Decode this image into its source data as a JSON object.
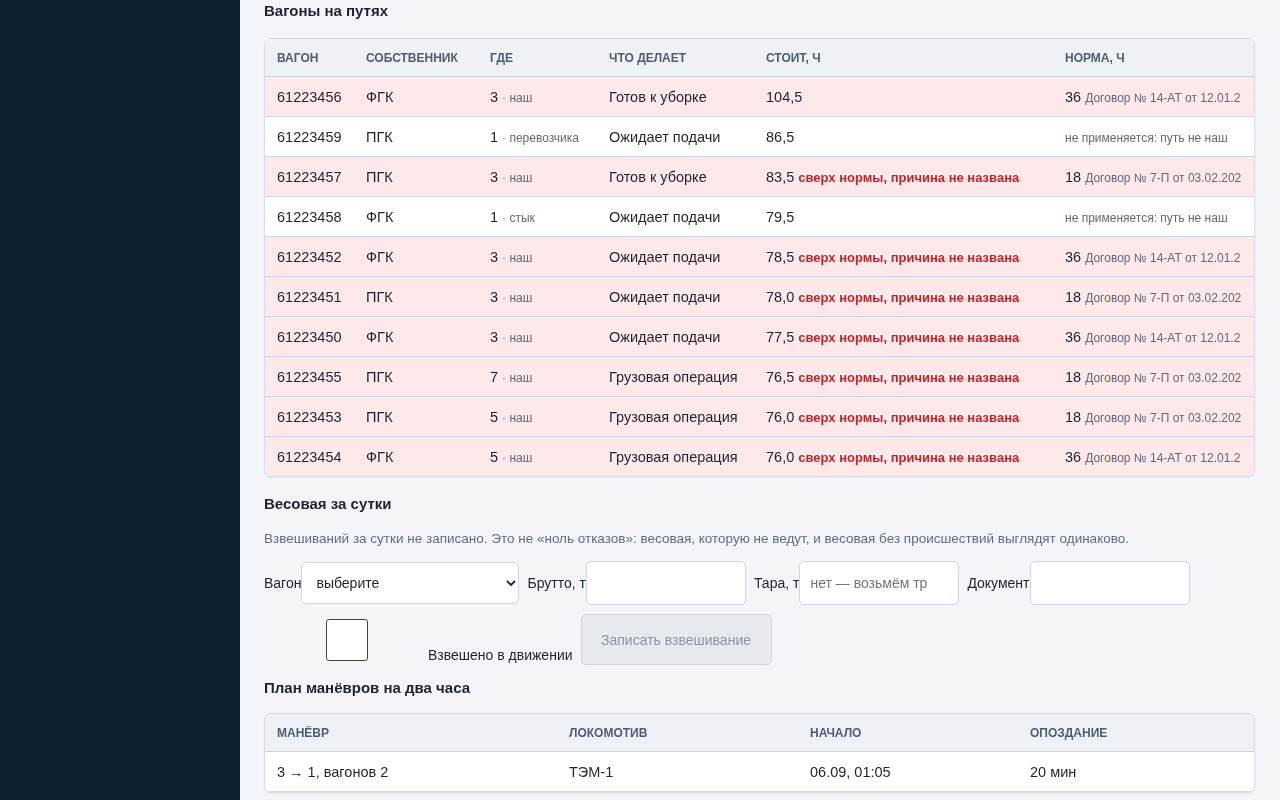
{
  "wagons": {
    "title": "Вагоны на путях",
    "columns": [
      "ВАГОН",
      "СОБСТВЕННИК",
      "ГДЕ",
      "ЧТО ДЕЛАЕТ",
      "СТОИТ, Ч",
      "НОРМА, Ч"
    ],
    "rows": [
      {
        "wagon": "61223456",
        "owner": "ФГК",
        "track": "3",
        "track_kind": "· наш",
        "activity": "Готов к уборке",
        "hours": "104,5",
        "norm": "36",
        "norm_note": "Договор № 14-АТ от 12.01.2",
        "highlighted": true
      },
      {
        "wagon": "61223459",
        "owner": "ПГК",
        "track": "1",
        "track_kind": "· перевозчика",
        "activity": "Ожидает подачи",
        "hours": "86,5",
        "norm_note": "не применяется: путь не наш",
        "highlighted": false
      },
      {
        "wagon": "61223457",
        "owner": "ПГК",
        "track": "3",
        "track_kind": "· наш",
        "activity": "Готов к уборке",
        "hours": "83,5",
        "hours_flag": "сверх нормы, причина не названа",
        "norm": "18",
        "norm_note": "Договор № 7-П от 03.02.202",
        "highlighted": true
      },
      {
        "wagon": "61223458",
        "owner": "ФГК",
        "track": "1",
        "track_kind": "· стык",
        "activity": "Ожидает подачи",
        "hours": "79,5",
        "norm_note": "не применяется: путь не наш",
        "highlighted": false
      },
      {
        "wagon": "61223452",
        "owner": "ФГК",
        "track": "3",
        "track_kind": "· наш",
        "activity": "Ожидает подачи",
        "hours": "78,5",
        "hours_flag": "сверх нормы, причина не названа",
        "norm": "36",
        "norm_note": "Договор № 14-АТ от 12.01.2",
        "highlighted": true
      },
      {
        "wagon": "61223451",
        "owner": "ПГК",
        "track": "3",
        "track_kind": "· наш",
        "activity": "Ожидает подачи",
        "hours": "78,0",
        "hours_flag": "сверх нормы, причина не названа",
        "norm": "18",
        "norm_note": "Договор № 7-П от 03.02.202",
        "highlighted": true
      },
      {
        "wagon": "61223450",
        "owner": "ФГК",
        "track": "3",
        "track_kind": "· наш",
        "activity": "Ожидает подачи",
        "hours": "77,5",
        "hours_flag": "сверх нормы, причина не названа",
        "norm": "36",
        "norm_note": "Договор № 14-АТ от 12.01.2",
        "highlighted": true
      },
      {
        "wagon": "61223455",
        "owner": "ПГК",
        "track": "7",
        "track_kind": "· наш",
        "activity": "Грузовая операция",
        "hours": "76,5",
        "hours_flag": "сверх нормы, причина не названа",
        "norm": "18",
        "norm_note": "Договор № 7-П от 03.02.202",
        "highlighted": true
      },
      {
        "wagon": "61223453",
        "owner": "ПГК",
        "track": "5",
        "track_kind": "· наш",
        "activity": "Грузовая операция",
        "hours": "76,0",
        "hours_flag": "сверх нормы, причина не названа",
        "norm": "18",
        "norm_note": "Договор № 7-П от 03.02.202",
        "highlighted": true
      },
      {
        "wagon": "61223454",
        "owner": "ФГК",
        "track": "5",
        "track_kind": "· наш",
        "activity": "Грузовая операция",
        "hours": "76,0",
        "hours_flag": "сверх нормы, причина не названа",
        "norm": "36",
        "norm_note": "Договор № 14-АТ от 12.01.2",
        "highlighted": true
      }
    ]
  },
  "weighing": {
    "title": "Весовая за сутки",
    "note": "Взвешиваний за сутки не записано. Это не «ноль отказов»: весовая, которую не ведут, и весовая без происшествий выглядят одинаково.",
    "wagon_label": "Вагон",
    "wagon_value": "выберите",
    "gross_label": "Брутто, т",
    "tare_label": "Тара, т",
    "tare_placeholder": "нет — возьмём тр",
    "doc_label": "Документ",
    "in_motion_checked": false,
    "in_motion_label": "Взвешено в движении",
    "submit": "Записать взвешивание",
    "submit_disabled": true
  },
  "plan": {
    "title": "План манёвров на два часа",
    "columns": [
      "МАНЁВР",
      "ЛОКОМОТИВ",
      "НАЧАЛО",
      "ОПОЗДАНИЕ"
    ],
    "rows": [
      [
        "3 → 1, вагонов 2",
        "ТЭМ-1",
        "06.09, 01:05",
        "20 мин"
      ]
    ]
  }
}
